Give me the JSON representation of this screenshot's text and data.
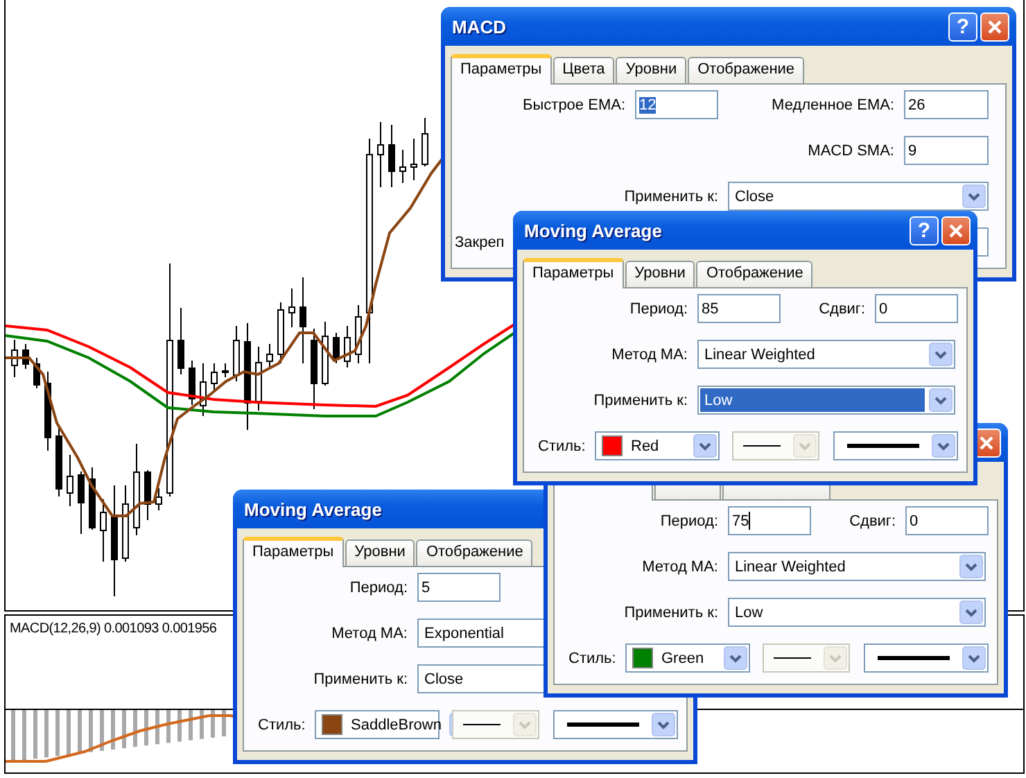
{
  "chart": {
    "indicator_label": "MACD(12,26,9) 0.001093 0.001956"
  },
  "dialogs": [
    {
      "kind": "macd",
      "title": "MACD",
      "help": "?",
      "tabs": [
        {
          "label": "Параметры",
          "selected": true
        },
        {
          "label": "Цвета",
          "selected": false
        },
        {
          "label": "Уровни",
          "selected": false
        },
        {
          "label": "Отображение",
          "selected": false
        }
      ],
      "rows": [
        {
          "kind": "pair",
          "fields": [
            {
              "label": "Быстрое EMA:",
              "value": "12",
              "text_selected": true,
              "caret": false
            },
            {
              "label": "Медленное EMA:",
              "value": "26",
              "text_selected": false,
              "caret": false
            }
          ]
        },
        {
          "kind": "right",
          "fields": [
            {
              "label": "MACD SMA:",
              "value": "9",
              "text_selected": false,
              "caret": false
            }
          ]
        },
        {
          "kind": "select",
          "fields": [
            {
              "label": "Применить к:",
              "value": "Close",
              "highlighted": false
            }
          ]
        },
        {
          "kind": "partial",
          "fields": [
            {
              "label": "Закреп"
            }
          ]
        }
      ]
    },
    {
      "kind": "ma",
      "title": "Moving Average",
      "help": "?",
      "tabs": [
        {
          "label": "Параметры",
          "selected": true
        },
        {
          "label": "Уровни",
          "selected": false
        },
        {
          "label": "Отображение",
          "selected": false
        }
      ],
      "rows": [
        {
          "kind": "pair",
          "fields": [
            {
              "label": "Период:",
              "value": "85",
              "text_selected": false,
              "caret": false
            },
            {
              "label": "Сдвиг:",
              "value": "0",
              "text_selected": false,
              "caret": false
            }
          ]
        },
        {
          "kind": "select",
          "fields": [
            {
              "label": "Метод МА:",
              "value": "Linear Weighted",
              "highlighted": false
            }
          ]
        },
        {
          "kind": "select",
          "fields": [
            {
              "label": "Применить к:",
              "value": "Low",
              "highlighted": true
            }
          ]
        },
        {
          "kind": "style",
          "label": "Стиль:",
          "color_name": "Red",
          "color": "#ff0000",
          "line_disabled": true
        }
      ]
    },
    {
      "kind": "ma",
      "tabs": [
        {
          "selected": true
        },
        {
          "selected": false
        },
        {
          "selected": false
        }
      ],
      "rows": [
        {
          "kind": "pair",
          "fields": [
            {
              "label": "Период:",
              "value": "75",
              "text_selected": false,
              "caret": true
            },
            {
              "label": "Сдвиг:",
              "value": "0",
              "text_selected": false,
              "caret": false
            }
          ]
        },
        {
          "kind": "select",
          "fields": [
            {
              "label": "Метод МА:",
              "value": "Linear Weighted",
              "highlighted": false
            }
          ]
        },
        {
          "kind": "select",
          "fields": [
            {
              "label": "Применить к:",
              "value": "Low",
              "highlighted": false
            }
          ]
        },
        {
          "kind": "style",
          "label": "Стиль:",
          "color_name": "Green",
          "color": "#008000",
          "line_disabled": true
        }
      ]
    },
    {
      "kind": "ma",
      "title": "Moving Average",
      "tabs": [
        {
          "label": "Параметры",
          "selected": true
        },
        {
          "label": "Уровни",
          "selected": false
        },
        {
          "label": "Отображение",
          "selected": false
        }
      ],
      "rows": [
        {
          "kind": "pair",
          "fields": [
            {
              "label": "Период:",
              "value": "5",
              "text_selected": false,
              "caret": false
            }
          ]
        },
        {
          "kind": "select",
          "fields": [
            {
              "label": "Метод МА:",
              "value": "Exponential",
              "highlighted": false
            }
          ]
        },
        {
          "kind": "select",
          "fields": [
            {
              "label": "Применить к:",
              "value": "Close",
              "highlighted": false
            }
          ]
        },
        {
          "kind": "style",
          "label": "Стиль:",
          "color_name": "SaddleBrown",
          "color": "#8b4513",
          "line_disabled": true
        }
      ]
    }
  ]
}
